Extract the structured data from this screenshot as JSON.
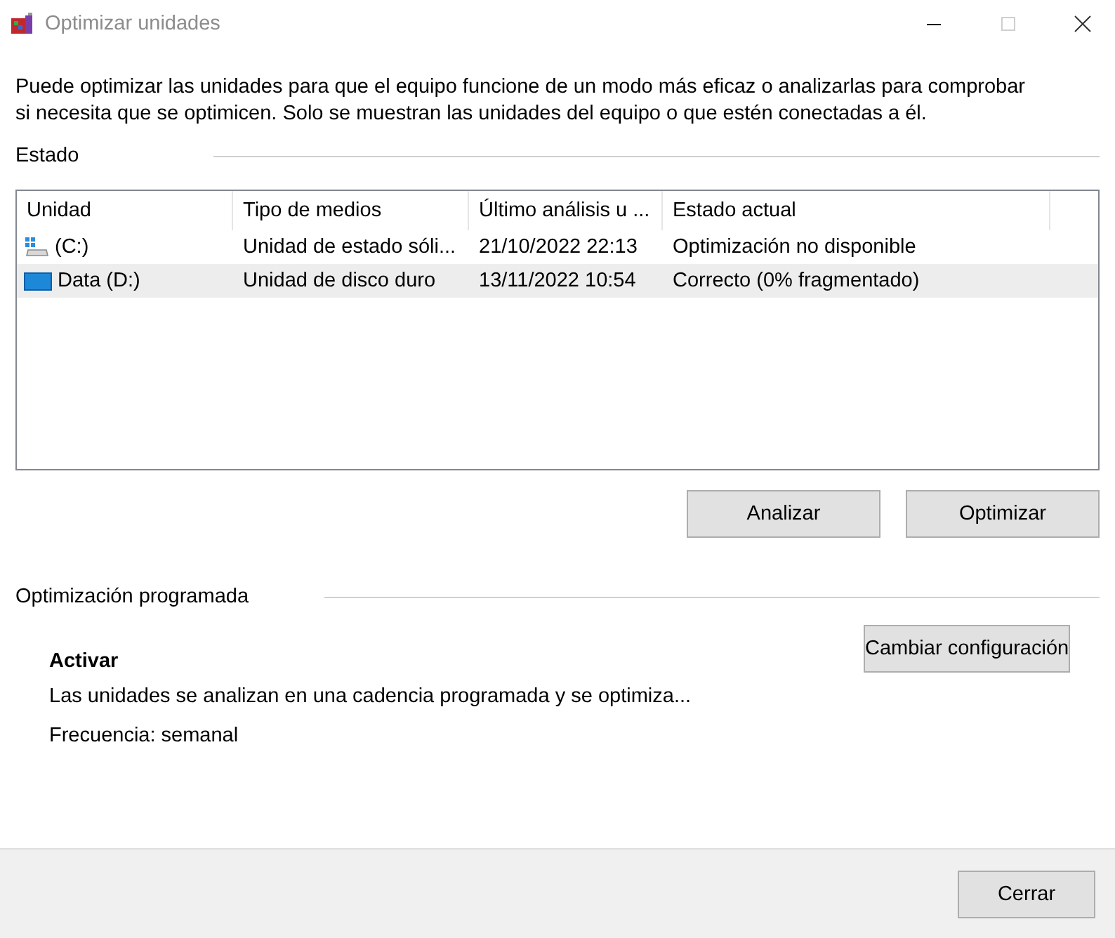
{
  "window": {
    "title": "Optimizar unidades"
  },
  "description": "Puede optimizar las unidades para que el equipo funcione de un modo más eficaz o analizarlas para comprobar si necesita que se optimicen. Solo se muestran las unidades del equipo o que estén conectadas a él.",
  "status_section": {
    "title": "Estado"
  },
  "drives": {
    "columns": [
      "Unidad",
      "Tipo de medios",
      "Último análisis u ...",
      "Estado actual"
    ],
    "rows": [
      {
        "kind": "system",
        "cells": [
          "(C:)",
          "Unidad de estado sóli...",
          "21/10/2022 22:13",
          "Optimización no disponible"
        ],
        "selected": false
      },
      {
        "kind": "data",
        "cells": [
          "Data (D:)",
          "Unidad de disco duro",
          "13/11/2022 10:54",
          "Correcto (0% fragmentado)"
        ],
        "selected": true
      }
    ]
  },
  "drive_buttons": [
    "Analizar",
    "Optimizar"
  ],
  "schedule": {
    "title": "Optimización programada",
    "state": "Activar",
    "detail": "Las unidades se analizan en una cadencia programada y se optimiza...",
    "frequency": "Frecuencia: semanal",
    "button": "Cambiar configuración"
  },
  "footer": {
    "button": "Cerrar"
  }
}
